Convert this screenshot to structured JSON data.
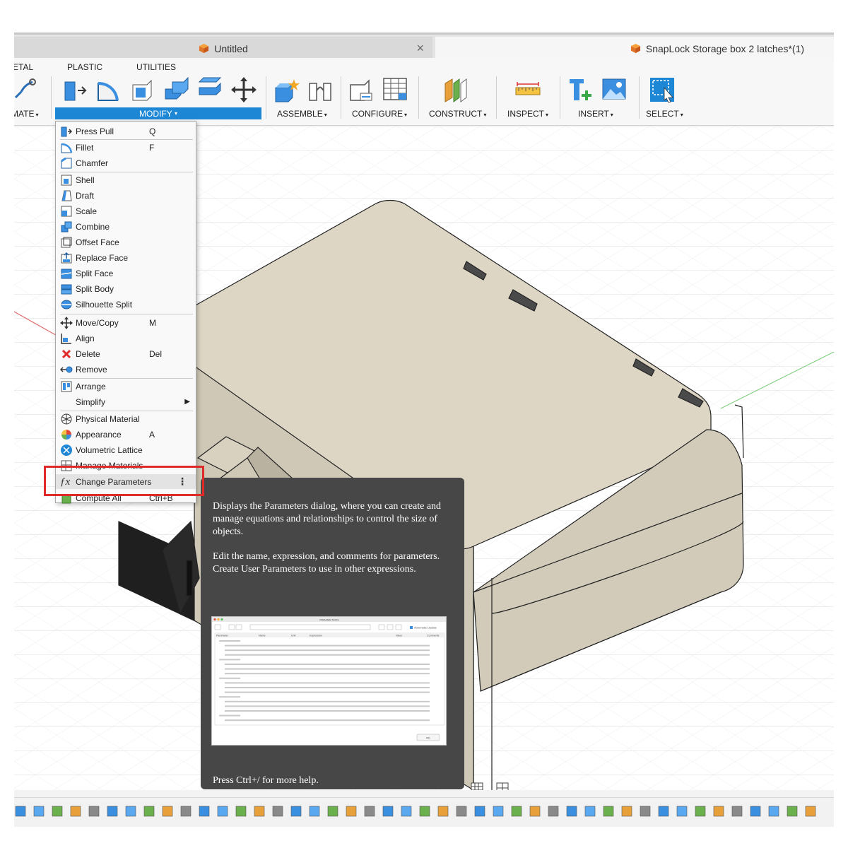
{
  "tabs": [
    {
      "label": "Untitled",
      "active": false
    },
    {
      "label": "SnapLock Storage box 2 latches*(1)",
      "active": true
    }
  ],
  "close_glyph": "×",
  "workspace_tabs": [
    "ETAL",
    "PLASTIC",
    "UTILITIES"
  ],
  "toolbar_groups": [
    {
      "label": "MATE",
      "caret": "▾"
    },
    {
      "label": "MODIFY",
      "caret": "▾"
    },
    {
      "label": "ASSEMBLE",
      "caret": "▾"
    },
    {
      "label": "CONFIGURE",
      "caret": "▾"
    },
    {
      "label": "CONSTRUCT",
      "caret": "▾"
    },
    {
      "label": "INSPECT",
      "caret": "▾"
    },
    {
      "label": "INSERT",
      "caret": "▾"
    },
    {
      "label": "SELECT",
      "caret": "▾"
    }
  ],
  "menu": {
    "items": [
      {
        "label": "Press Pull",
        "shortcut": "Q",
        "icon": "press-pull-icon"
      },
      {
        "label": "Fillet",
        "shortcut": "F",
        "icon": "fillet-icon"
      },
      {
        "label": "Chamfer",
        "shortcut": "",
        "icon": "chamfer-icon"
      },
      {
        "label": "Shell",
        "shortcut": "",
        "icon": "shell-icon"
      },
      {
        "label": "Draft",
        "shortcut": "",
        "icon": "draft-icon"
      },
      {
        "label": "Scale",
        "shortcut": "",
        "icon": "scale-icon"
      },
      {
        "label": "Combine",
        "shortcut": "",
        "icon": "combine-icon"
      },
      {
        "label": "Offset Face",
        "shortcut": "",
        "icon": "offset-face-icon"
      },
      {
        "label": "Replace Face",
        "shortcut": "",
        "icon": "replace-face-icon"
      },
      {
        "label": "Split Face",
        "shortcut": "",
        "icon": "split-face-icon"
      },
      {
        "label": "Split Body",
        "shortcut": "",
        "icon": "split-body-icon"
      },
      {
        "label": "Silhouette Split",
        "shortcut": "",
        "icon": "silhouette-split-icon"
      },
      {
        "label": "Move/Copy",
        "shortcut": "M",
        "icon": "move-copy-icon"
      },
      {
        "label": "Align",
        "shortcut": "",
        "icon": "align-icon"
      },
      {
        "label": "Delete",
        "shortcut": "Del",
        "icon": "delete-icon"
      },
      {
        "label": "Remove",
        "shortcut": "",
        "icon": "remove-icon"
      },
      {
        "label": "Arrange",
        "shortcut": "",
        "icon": "arrange-icon"
      },
      {
        "label": "Simplify",
        "shortcut": "",
        "icon": "simplify-icon",
        "submenu": "▶"
      },
      {
        "label": "Physical Material",
        "shortcut": "",
        "icon": "physical-material-icon"
      },
      {
        "label": "Appearance",
        "shortcut": "A",
        "icon": "appearance-icon"
      },
      {
        "label": "Volumetric Lattice",
        "shortcut": "",
        "icon": "volumetric-lattice-icon"
      },
      {
        "label": "Manage Materials",
        "shortcut": "",
        "icon": "manage-materials-icon"
      },
      {
        "label": "Change Parameters",
        "shortcut": "",
        "icon": "fx-icon",
        "kebab": "⋮"
      },
      {
        "label": "Compute All",
        "shortcut": "Ctrl+B",
        "icon": "compute-all-icon"
      }
    ]
  },
  "tooltip": {
    "p1": "Displays the Parameters dialog, where you can create and manage equations and relationships to control the size of objects.",
    "p2": "Edit the name, expression, and comments for parameters. Create User Parameters to use in other expressions.",
    "help": "Press Ctrl+/ for more help.",
    "preview": {
      "title": "PARAMETERS",
      "checkbox": "Automatic Update",
      "headers": [
        "Parameter",
        "Name",
        "Unit",
        "Expression",
        "Value",
        "Comments"
      ],
      "ok": "OK"
    }
  },
  "colors": {
    "accent": "#1d87d6",
    "highlight": "#e02a2a",
    "tooltip_bg": "#474747",
    "model": "#dcd6c6"
  }
}
